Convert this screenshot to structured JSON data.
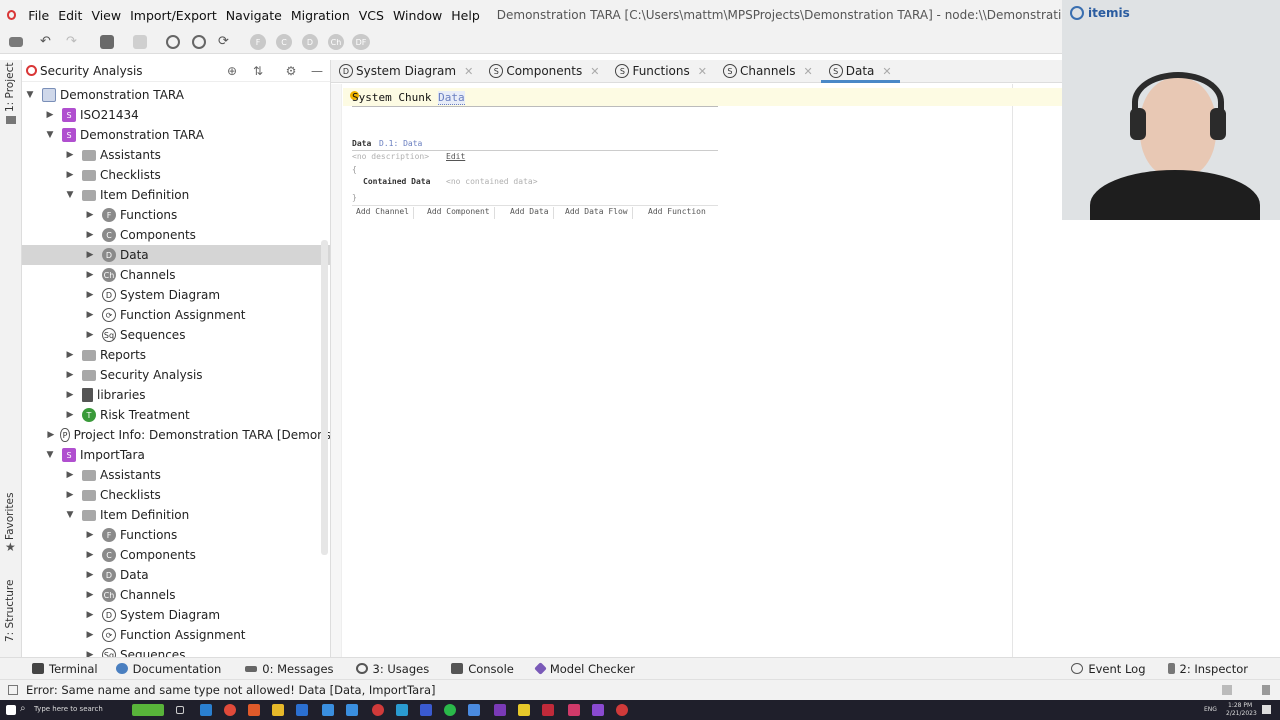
{
  "menu": {
    "items": [
      "File",
      "Edit",
      "View",
      "Import/Export",
      "Navigate",
      "Migration",
      "VCS",
      "Window",
      "Help"
    ],
    "window_title": "Demonstration TARA [C:\\Users\\mattm\\MPSProjects\\Demonstration TARA] - node:\\\\Demonstration TARA\\Demonstration"
  },
  "toolbar": {
    "circle_buttons": [
      "F",
      "C",
      "D",
      "Ch",
      "DF"
    ]
  },
  "left_strip": {
    "project_label": "1: Project",
    "favorites_label": "Favorites",
    "structure_label": "7: Structure"
  },
  "panel": {
    "title": "Security Analysis",
    "tree": [
      {
        "label": "Demonstration TARA",
        "icon": "module-icon",
        "level": 0,
        "expanded": true
      },
      {
        "label": "ISO21434",
        "icon": "S",
        "level": 1,
        "expanded": false
      },
      {
        "label": "Demonstration TARA",
        "icon": "S",
        "level": 1,
        "expanded": true
      },
      {
        "label": "Assistants",
        "icon": "folder",
        "level": 2,
        "expanded": false
      },
      {
        "label": "Checklists",
        "icon": "folder",
        "level": 2,
        "expanded": false
      },
      {
        "label": "Item Definition",
        "icon": "folder",
        "level": 2,
        "expanded": true
      },
      {
        "label": "Functions",
        "icon": "F",
        "level": 3,
        "expanded": false
      },
      {
        "label": "Components",
        "icon": "C",
        "level": 3,
        "expanded": false
      },
      {
        "label": "Data",
        "icon": "D",
        "level": 3,
        "expanded": false,
        "selected": true
      },
      {
        "label": "Channels",
        "icon": "Ch",
        "level": 3,
        "expanded": false
      },
      {
        "label": "System Diagram",
        "icon": "D-hollow",
        "level": 3,
        "expanded": false
      },
      {
        "label": "Function Assignment",
        "icon": "FA",
        "level": 3,
        "expanded": false
      },
      {
        "label": "Sequences",
        "icon": "Sq",
        "level": 3,
        "expanded": false
      },
      {
        "label": "Reports",
        "icon": "folder",
        "level": 2,
        "expanded": false
      },
      {
        "label": "Security Analysis",
        "icon": "folder",
        "level": 2,
        "expanded": false
      },
      {
        "label": "libraries",
        "icon": "book",
        "level": 2,
        "expanded": false
      },
      {
        "label": "Risk Treatment",
        "icon": "T",
        "level": 2,
        "expanded": false
      },
      {
        "label": "Project Info: Demonstration TARA [Demons",
        "icon": "P",
        "level": 2,
        "expanded": false
      },
      {
        "label": "ImportTara",
        "icon": "S",
        "level": 1,
        "expanded": true
      },
      {
        "label": "Assistants",
        "icon": "folder",
        "level": 2,
        "expanded": false
      },
      {
        "label": "Checklists",
        "icon": "folder",
        "level": 2,
        "expanded": false
      },
      {
        "label": "Item Definition",
        "icon": "folder",
        "level": 2,
        "expanded": true
      },
      {
        "label": "Functions",
        "icon": "F",
        "level": 3,
        "expanded": false
      },
      {
        "label": "Components",
        "icon": "C",
        "level": 3,
        "expanded": false
      },
      {
        "label": "Data",
        "icon": "D",
        "level": 3,
        "expanded": false
      },
      {
        "label": "Channels",
        "icon": "Ch",
        "level": 3,
        "expanded": false
      },
      {
        "label": "System Diagram",
        "icon": "D-hollow",
        "level": 3,
        "expanded": false
      },
      {
        "label": "Function Assignment",
        "icon": "FA",
        "level": 3,
        "expanded": false
      },
      {
        "label": "Sequences",
        "icon": "Sq",
        "level": 3,
        "expanded": false
      }
    ]
  },
  "tabs": [
    {
      "icon": "D",
      "label": "System Diagram",
      "active": false
    },
    {
      "icon": "S",
      "label": "Components",
      "active": false
    },
    {
      "icon": "S",
      "label": "Functions",
      "active": false
    },
    {
      "icon": "S",
      "label": "Channels",
      "active": false
    },
    {
      "icon": "S",
      "label": "Data",
      "active": true
    }
  ],
  "editor": {
    "chunk_keyword": "System Chunk",
    "chunk_name": "Data",
    "data_keyword": "Data",
    "data_id": "D.1: Data",
    "no_description": "<no description>",
    "edit_link": "Edit",
    "open_brace": "{",
    "contained_label": "Contained Data",
    "no_contained": "<no contained data>",
    "close_brace": "}",
    "buttons": [
      "Add Channel",
      "Add Component",
      "Add Data",
      "Add Data Flow",
      "Add Function"
    ]
  },
  "webcam": {
    "logo_text": "itemis"
  },
  "bottom_tools": {
    "left": [
      "Terminal",
      "Documentation",
      "0: Messages",
      "3: Usages",
      "Console",
      "Model Checker"
    ],
    "right": [
      "Event Log",
      "2: Inspector"
    ]
  },
  "status": {
    "message": "Error: Same name and same type not allowed! Data [Data, ImportTara]"
  },
  "taskbar": {
    "search_placeholder": "Type here to search",
    "time": "1:28 PM",
    "date": "2/21/2023",
    "lang": "ENG"
  },
  "colors": {
    "selection": "#d5d5d5",
    "accent": "#4a88c7",
    "error": "#d93636",
    "s_icon": "#b04fcf"
  }
}
